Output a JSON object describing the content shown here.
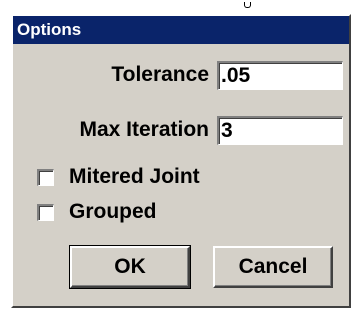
{
  "dialog": {
    "title": "Options"
  },
  "fields": {
    "tolerance": {
      "label": "Tolerance",
      "value": ".05"
    },
    "max_iteration": {
      "label": "Max Iteration",
      "value": "3"
    }
  },
  "checkboxes": {
    "mitered_joint": {
      "label": "Mitered Joint",
      "checked": false
    },
    "grouped": {
      "label": "Grouped",
      "checked": false
    }
  },
  "buttons": {
    "ok_label": "OK",
    "cancel_label": "Cancel"
  }
}
